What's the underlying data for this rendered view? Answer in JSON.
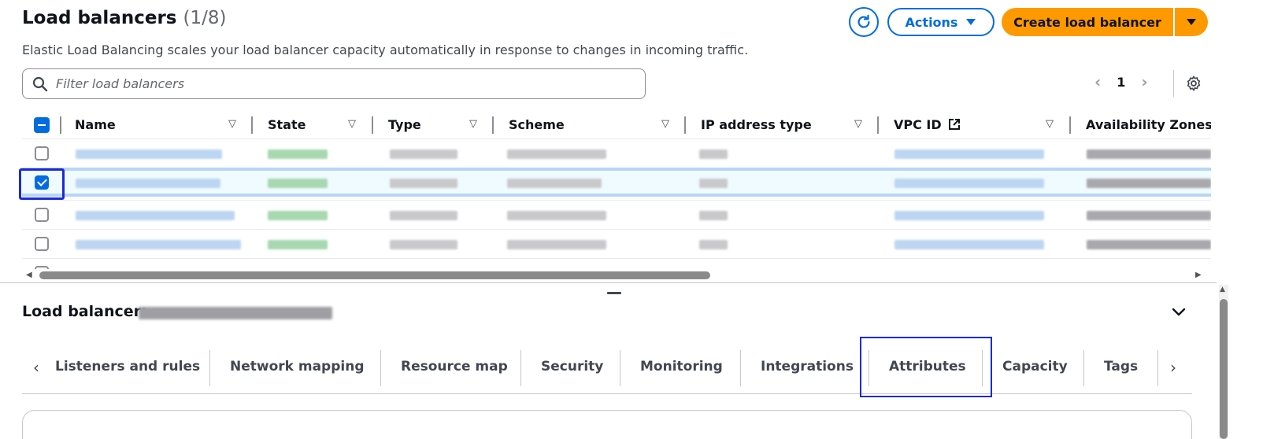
{
  "header": {
    "title": "Load balancers",
    "count": "(1/8)",
    "description": "Elastic Load Balancing scales your load balancer capacity automatically in response to changes in incoming traffic.",
    "actions_label": "Actions",
    "create_label": "Create load balancer"
  },
  "filter": {
    "placeholder": "Filter load balancers"
  },
  "pagination": {
    "current_page": "1"
  },
  "table": {
    "columns": [
      "Name",
      "State",
      "Type",
      "Scheme",
      "IP address type",
      "VPC ID",
      "Availability Zones"
    ],
    "selected_row_index": 1
  },
  "detail": {
    "title_prefix": "Load balancer:",
    "tabs": [
      "Listeners and rules",
      "Network mapping",
      "Resource map",
      "Security",
      "Monitoring",
      "Integrations",
      "Attributes",
      "Capacity",
      "Tags"
    ],
    "highlighted_tab": "Attributes"
  },
  "colors": {
    "accent": "#006ce0",
    "primary_button": "#ff9900",
    "highlight_frame": "#1a2bd6",
    "selected_row": "#f0fbff"
  },
  "icons": [
    "refresh-icon",
    "caret-down-icon",
    "search-icon",
    "chevron-left-icon",
    "chevron-right-icon",
    "settings-icon",
    "external-link-icon",
    "filter-caret-icon",
    "chevron-down-icon"
  ]
}
